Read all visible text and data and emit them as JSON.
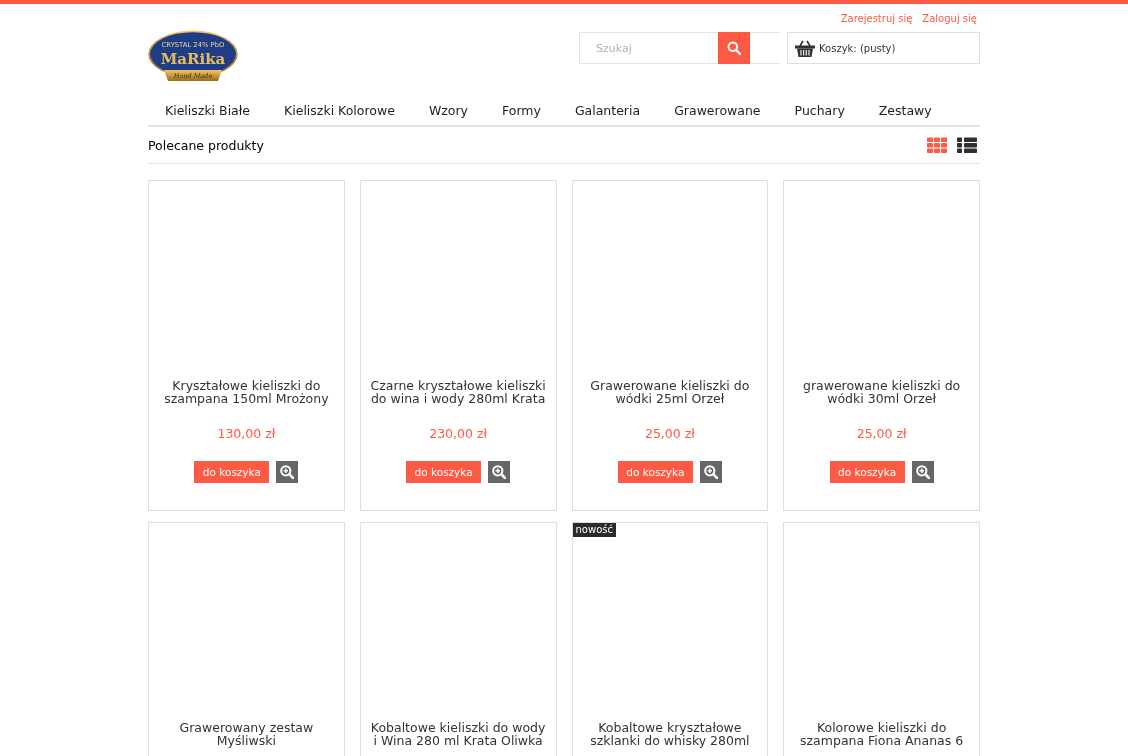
{
  "top_links": [
    {
      "label": "Zarejestruj się"
    },
    {
      "label": "Zaloguj się"
    }
  ],
  "logo": {
    "tagline": "CRYSTAL 24% PbO",
    "name": "MaRika",
    "ribbon": "Hand Made"
  },
  "search": {
    "placeholder": "Szukaj"
  },
  "cart": {
    "label": "Koszyk: (pusty)"
  },
  "nav": {
    "items": [
      {
        "label": "Kieliszki Białe"
      },
      {
        "label": "Kieliszki Kolorowe"
      },
      {
        "label": "Wzory"
      },
      {
        "label": "Formy"
      },
      {
        "label": "Galanteria"
      },
      {
        "label": "Grawerowane"
      },
      {
        "label": "Puchary"
      },
      {
        "label": "Zestawy"
      }
    ]
  },
  "section": {
    "title": "Polecane produkty",
    "view_modes": [
      {
        "kind": "grid",
        "selected": true
      },
      {
        "kind": "list",
        "selected": false
      }
    ]
  },
  "products": [
    {
      "name": "Kryształowe kieliszki do szampana 150ml Mrożony",
      "price": "130,00 zł",
      "cart_button": "do koszyka"
    },
    {
      "name": "Czarne kryształowe kieliszki do wina i wody 280ml Krata",
      "price": "230,00 zł",
      "cart_button": "do koszyka"
    },
    {
      "name": "Grawerowane kieliszki do wódki 25ml Orzeł",
      "price": "25,00 zł",
      "cart_button": "do koszyka"
    },
    {
      "name": "grawerowane kieliszki do wódki 30ml Orzeł",
      "price": "25,00 zł",
      "cart_button": "do koszyka"
    },
    {
      "name": "Grawerowany zestaw Myśliwski"
    },
    {
      "name": "Kobaltowe kieliszki do wody i Wina 280 ml Krata Oliwka"
    },
    {
      "name": "Kobaltowe kryształowe szklanki do whisky 280ml",
      "badge": "nowość"
    },
    {
      "name": "Kolorowe kieliszki do szampana Fiona Ananas 6"
    }
  ]
}
